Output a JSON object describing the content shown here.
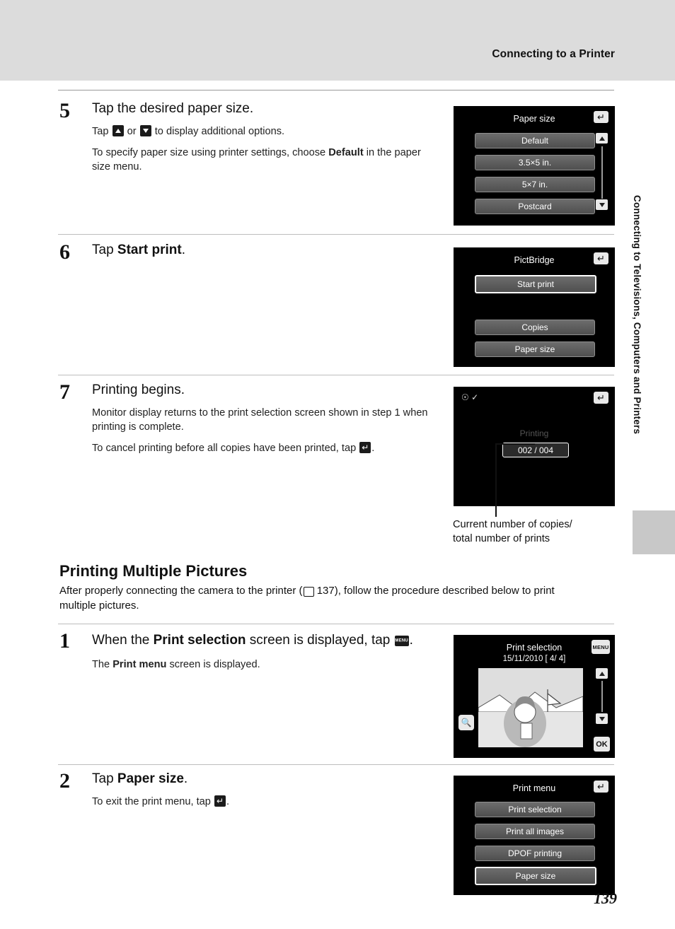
{
  "header": {
    "title": "Connecting to a Printer"
  },
  "side_tab": {
    "text": "Connecting to Televisions, Computers and Printers"
  },
  "page_number": "139",
  "steps": [
    {
      "num": "5",
      "title": "Tap the desired paper size.",
      "p1_a": "Tap ",
      "p1_b": " or ",
      "p1_c": " to display additional options.",
      "p2_a": "To specify paper size using printer settings, choose ",
      "p2_b": "Default",
      "p2_c": " in the paper size menu."
    },
    {
      "num": "6",
      "title_a": "Tap ",
      "title_b": "Start print",
      "title_c": "."
    },
    {
      "num": "7",
      "title": "Printing begins.",
      "p1": "Monitor display returns to the print selection screen shown in step 1 when printing is complete.",
      "p2_a": "To cancel printing before all copies have been printed, tap ",
      "p2_b": "."
    },
    {
      "num": "1",
      "title_a": "When the ",
      "title_b": "Print selection",
      "title_c": " screen is displayed, tap ",
      "title_d": ".",
      "p1_a": "The ",
      "p1_b": "Print menu",
      "p1_c": " screen is displayed."
    },
    {
      "num": "2",
      "title_a": "Tap ",
      "title_b": "Paper size",
      "title_c": ".",
      "p1_a": "To exit the print menu, tap ",
      "p1_b": "."
    }
  ],
  "section": {
    "heading": "Printing Multiple Pictures",
    "body_a": "After properly connecting the camera to the printer (",
    "body_ref": "137",
    "body_b": "), follow the procedure described below to print multiple pictures."
  },
  "screen_paper_size": {
    "title": "Paper size",
    "items": [
      "Default",
      "3.5×5 in.",
      "5×7 in.",
      "Postcard"
    ],
    "back_icon": "back-icon",
    "up_icon": "scroll-up-icon",
    "down_icon": "scroll-down-icon"
  },
  "screen_pictbridge": {
    "title": "PictBridge",
    "items": [
      "Start print",
      "Copies",
      "Paper size"
    ],
    "highlighted": "Start print",
    "back_icon": "back-icon"
  },
  "screen_printing": {
    "status": "Printing",
    "counter": "002 / 004",
    "back_icon": "back-icon",
    "caption_line1": "Current number of copies/",
    "caption_line2": "total number of prints"
  },
  "screen_print_selection": {
    "title": "Print selection",
    "date": "15/11/2010",
    "counter_open": "[",
    "counter": "4/    4]",
    "menu_icon": "MENU",
    "ok_icon": "OK",
    "zoom_icon": "🔍",
    "up_icon": "scroll-up-icon",
    "down_icon": "scroll-down-icon"
  },
  "screen_print_menu": {
    "title": "Print menu",
    "items": [
      "Print selection",
      "Print all images",
      "DPOF printing",
      "Paper size"
    ],
    "highlighted": "Paper size",
    "back_icon": "back-icon"
  }
}
